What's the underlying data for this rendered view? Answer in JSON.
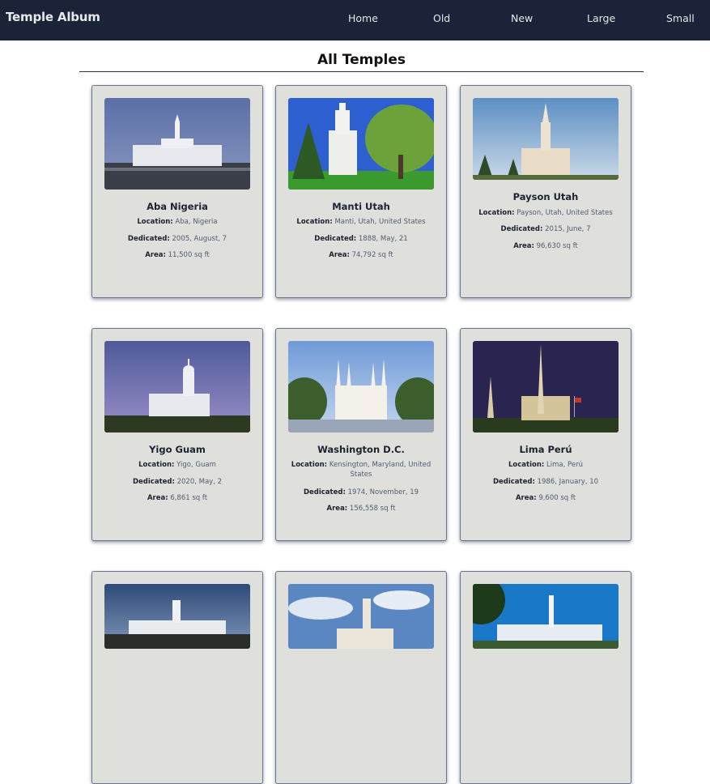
{
  "header": {
    "brand": "Temple Album",
    "nav": [
      {
        "label": "Home"
      },
      {
        "label": "Old"
      },
      {
        "label": "New"
      },
      {
        "label": "Large"
      },
      {
        "label": "Small"
      }
    ]
  },
  "main": {
    "title": "All Temples",
    "labels": {
      "location": "Location:",
      "dedicated": "Dedicated:",
      "area": "Area:"
    },
    "temples": [
      {
        "name": "Aba Nigeria",
        "location": "Aba, Nigeria",
        "dedicated": "2005, August, 7",
        "area": "11,500 sq ft"
      },
      {
        "name": "Manti Utah",
        "location": "Manti, Utah, United States",
        "dedicated": "1888, May, 21",
        "area": "74,792 sq ft"
      },
      {
        "name": "Payson Utah",
        "location": "Payson, Utah, United States",
        "dedicated": "2015, June, 7",
        "area": "96,630 sq ft"
      },
      {
        "name": "Yigo Guam",
        "location": "Yigo, Guam",
        "dedicated": "2020, May, 2",
        "area": "6,861 sq ft"
      },
      {
        "name": "Washington D.C.",
        "location": "Kensington, Maryland, United States",
        "dedicated": "1974, November, 19",
        "area": "156,558 sq ft"
      },
      {
        "name": "Lima Perú",
        "location": "Lima, Perú",
        "dedicated": "1986, January, 10",
        "area": "9,600 sq ft"
      }
    ]
  }
}
